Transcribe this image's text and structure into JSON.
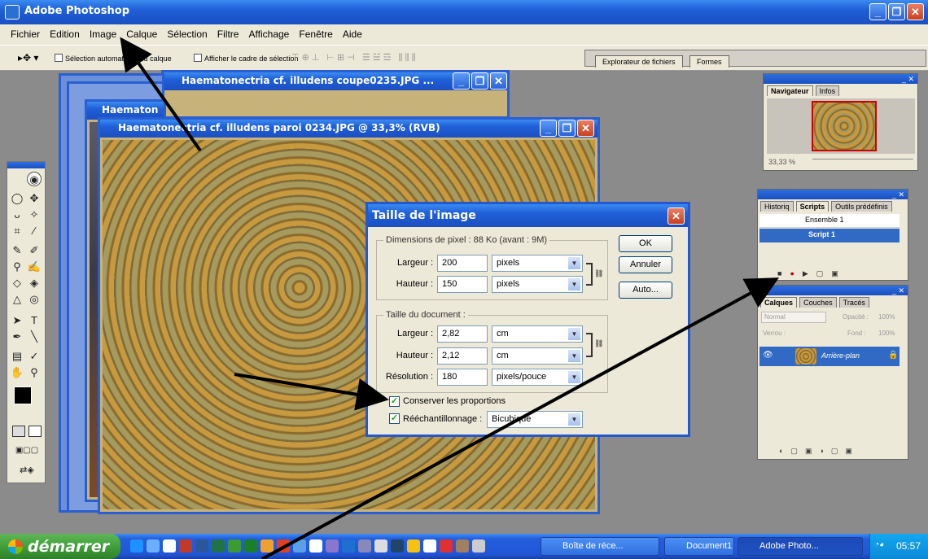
{
  "app": {
    "title": "Adobe Photoshop"
  },
  "menu": [
    "Fichier",
    "Edition",
    "Image",
    "Calque",
    "Sélection",
    "Filtre",
    "Affichage",
    "Fenêtre",
    "Aide"
  ],
  "options": {
    "auto_select": "Sélection automatique du calque",
    "show_bounds": "Afficher le cadre de sélection",
    "tabs": [
      "Explorateur de fichiers",
      "Formes"
    ]
  },
  "documents": {
    "back_title": "Haematonectria cf. illudens coupe0235.JPG ...",
    "mid_title": "Haematon",
    "front_title": "Haematonectria cf. illudens paroi 0234.JPG @ 33,3% (RVB)"
  },
  "dialog": {
    "title": "Taille de l'image",
    "pixel_legend": "Dimensions de pixel : 88 Ko (avant : 9M)",
    "width_label": "Largeur :",
    "width_px": "200",
    "height_label": "Hauteur :",
    "height_px": "150",
    "unit_pixels": "pixels",
    "doc_legend": "Taille du document :",
    "width_cm": "2,82",
    "height_cm": "2,12",
    "unit_cm": "cm",
    "resolution_label": "Résolution :",
    "resolution": "180",
    "unit_res": "pixels/pouce",
    "constrain": "Conserver les proportions",
    "resample": "Rééchantillonnage :",
    "resample_method": "Bicubique",
    "ok": "OK",
    "cancel": "Annuler",
    "auto": "Auto..."
  },
  "navigator": {
    "tabs": [
      "Navigateur",
      "Infos"
    ],
    "zoom": "33,33 %"
  },
  "scripts": {
    "tabs": [
      "Historiq",
      "Scripts",
      "Outils prédéfinis"
    ],
    "items": [
      "Ensemble 1",
      "Script 1"
    ]
  },
  "layers": {
    "tabs": [
      "Calques",
      "Couches",
      "Tracés"
    ],
    "mode": "Normal",
    "opacity_label": "Opacité :",
    "opacity": "100%",
    "lock_label": "Verrou :",
    "fill_label": "Fond :",
    "fill": "100%",
    "layer_name": "Arrière-plan"
  },
  "taskbar": {
    "start": "démarrer",
    "items": [
      "Boîte de réce...",
      "Document1 ...",
      "Adobe Photo..."
    ],
    "clock": "05:57"
  }
}
